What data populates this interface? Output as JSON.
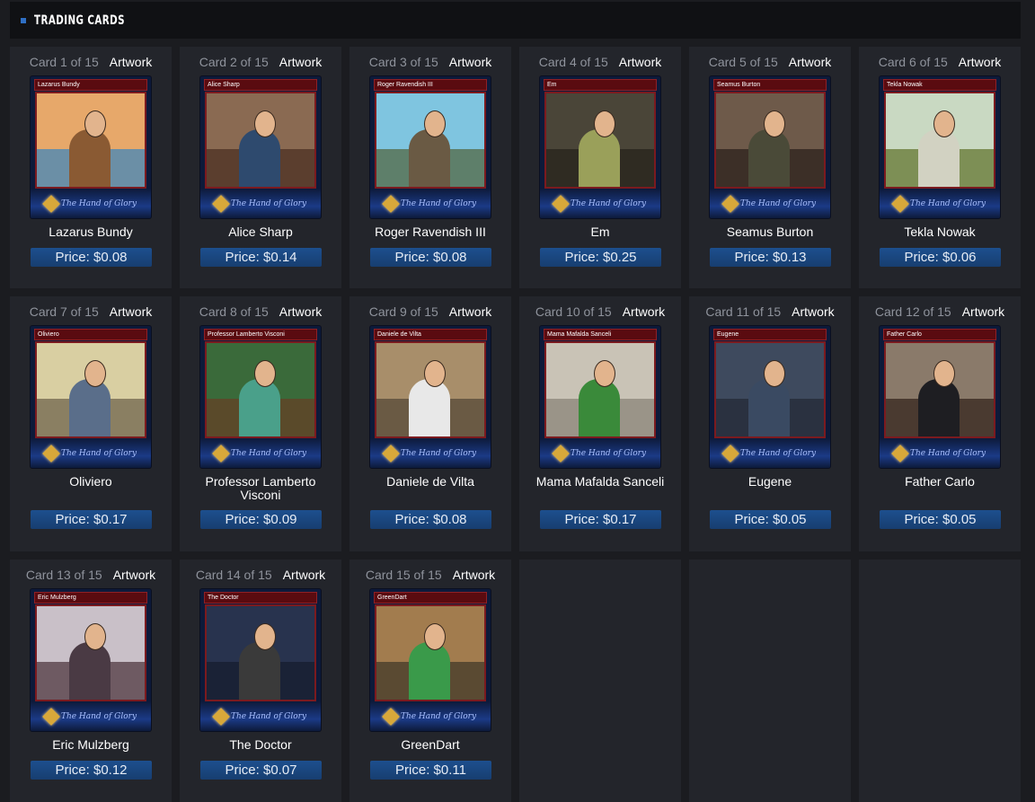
{
  "header": {
    "title": "TRADING CARDS"
  },
  "artwork_label": "Artwork",
  "price_prefix": "Price:",
  "logo_text": "The Hand of Glory",
  "cards": [
    {
      "num": "Card 1 of 15",
      "name": "Lazarus Bundy",
      "price": "$0.08",
      "sky": "#e7a86a",
      "ground": "#6b8fa6",
      "body": "#8a5a33"
    },
    {
      "num": "Card 2 of 15",
      "name": "Alice Sharp",
      "price": "$0.14",
      "sky": "#8a6a52",
      "ground": "#5b3e2e",
      "body": "#2e4a6e"
    },
    {
      "num": "Card 3 of 15",
      "name": "Roger Ravendish III",
      "price": "$0.08",
      "sky": "#7fc5e0",
      "ground": "#5e7f6a",
      "body": "#6a5a44"
    },
    {
      "num": "Card 4 of 15",
      "name": "Em",
      "price": "$0.25",
      "sky": "#4a4538",
      "ground": "#2f2b22",
      "body": "#9aa05a"
    },
    {
      "num": "Card 5 of 15",
      "name": "Seamus Burton",
      "price": "$0.13",
      "sky": "#6e5a4a",
      "ground": "#3c2f27",
      "body": "#4a4a38"
    },
    {
      "num": "Card 6 of 15",
      "name": "Tekla Nowak",
      "price": "$0.06",
      "sky": "#c9d9c2",
      "ground": "#7d8f55",
      "body": "#d2d2c2"
    },
    {
      "num": "Card 7 of 15",
      "name": "Oliviero",
      "price": "$0.17",
      "sky": "#d9cfa2",
      "ground": "#8a7f62",
      "body": "#5a6e8a"
    },
    {
      "num": "Card 8 of 15",
      "name": "Professor Lamberto Visconi",
      "price": "$0.09",
      "sky": "#3a6a3a",
      "ground": "#5a4a2a",
      "body": "#4aa08a"
    },
    {
      "num": "Card 9 of 15",
      "name": "Daniele de Vilta",
      "price": "$0.08",
      "sky": "#a88e6a",
      "ground": "#6a5a44",
      "body": "#e8e8e8"
    },
    {
      "num": "Card 10 of 15",
      "name": "Mama Mafalda Sanceli",
      "price": "$0.17",
      "sky": "#c9c3b6",
      "ground": "#9a9488",
      "body": "#3a8a3a"
    },
    {
      "num": "Card 11 of 15",
      "name": "Eugene",
      "price": "$0.05",
      "sky": "#3e4a5e",
      "ground": "#2a3140",
      "body": "#3a4a62"
    },
    {
      "num": "Card 12 of 15",
      "name": "Father Carlo",
      "price": "$0.05",
      "sky": "#8a7a6a",
      "ground": "#4a3a30",
      "body": "#1e1e22"
    },
    {
      "num": "Card 13 of 15",
      "name": "Eric Mulzberg",
      "price": "$0.12",
      "sky": "#c9c0c8",
      "ground": "#6e5a62",
      "body": "#4a3a44"
    },
    {
      "num": "Card 14 of 15",
      "name": "The Doctor",
      "price": "$0.07",
      "sky": "#28334e",
      "ground": "#1a2236",
      "body": "#3a3a3a"
    },
    {
      "num": "Card 15 of 15",
      "name": "GreenDart",
      "price": "$0.11",
      "sky": "#a27c4e",
      "ground": "#5a4a32",
      "body": "#3a9a4a"
    }
  ]
}
